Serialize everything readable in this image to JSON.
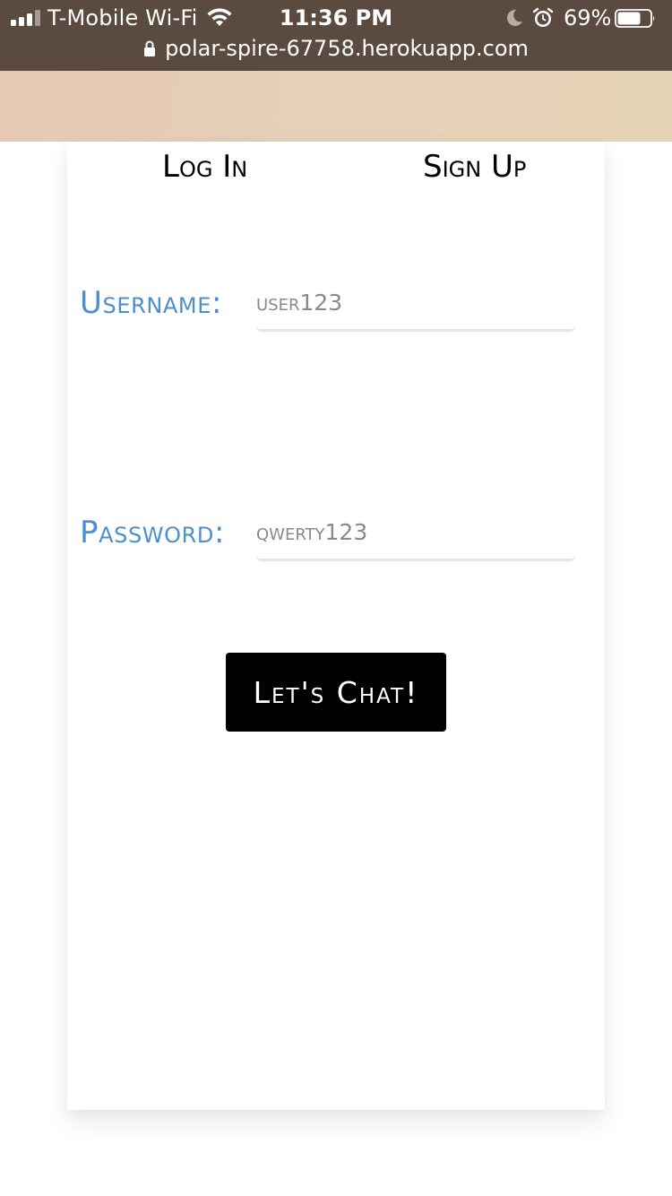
{
  "status_bar": {
    "carrier": "T-Mobile Wi-Fi",
    "time": "11:36 PM",
    "battery_percent": "69%",
    "icons": [
      "signal-icon",
      "wifi-icon",
      "moon-icon",
      "alarm-icon",
      "battery-icon"
    ]
  },
  "browser": {
    "url": "polar-spire-67758.herokuapp.com",
    "lock_icon": "lock-icon"
  },
  "tabs": {
    "login": "Log In",
    "signup": "Sign Up"
  },
  "form": {
    "username_label": "Username:",
    "username_placeholder": "user123",
    "password_label": "Password:",
    "password_placeholder": "qwerty123",
    "submit_label": "Let's Chat!"
  },
  "colors": {
    "status_bar_bg": "#5a4a3f",
    "label_blue": "#4d8fce",
    "button_bg": "#000000"
  }
}
